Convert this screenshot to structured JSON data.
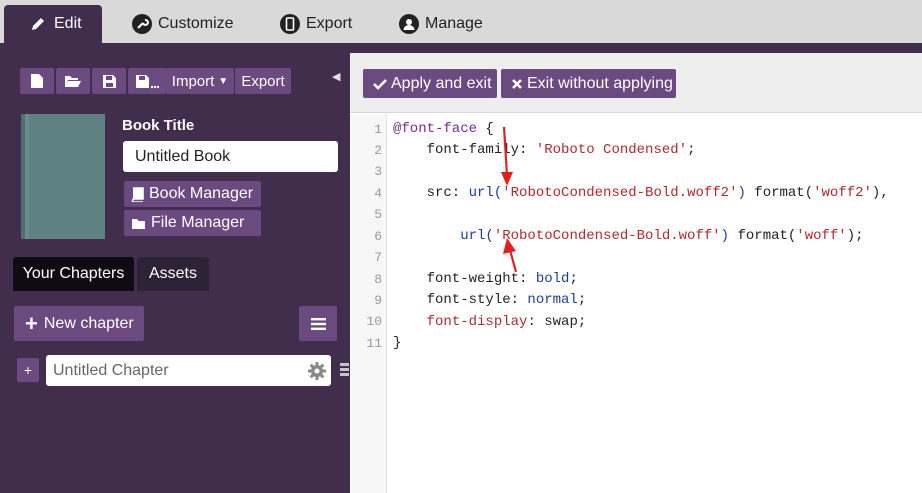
{
  "top_tabs": [
    {
      "label": "Edit",
      "icon": "pencil-icon",
      "active": true
    },
    {
      "label": "Customize",
      "icon": "wrench-icon",
      "active": false
    },
    {
      "label": "Export",
      "icon": "phone-icon",
      "active": false
    },
    {
      "label": "Manage",
      "icon": "user-icon",
      "active": false
    }
  ],
  "toolbar": {
    "import_label": "Import",
    "export_label": "Export"
  },
  "book": {
    "title_label": "Book Title",
    "title_value": "Untitled Book",
    "book_manager_label": "Book Manager",
    "file_manager_label": "File Manager"
  },
  "chapter_tabs": {
    "your_chapters": "Your Chapters",
    "assets": "Assets"
  },
  "new_chapter_label": "New chapter",
  "chapter": {
    "plus_label": "+",
    "title_value": "Untitled Chapter"
  },
  "actions": {
    "apply_label": "Apply and exit",
    "exit_label": "Exit without applying"
  },
  "editor": {
    "line_numbers": [
      "1",
      "2",
      "3",
      "4",
      "5",
      "6",
      "7",
      "8",
      "9",
      "10",
      "11"
    ],
    "lines": {
      "l1_at": "@font-face",
      "l1_brace": " {",
      "l2_prop": "    font-family: ",
      "l2_str": "'Roboto Condensed'",
      "l2_end": ";",
      "l4_prop": "    src: ",
      "l4_fn": "url(",
      "l4_str": "'RobotoCondensed-Bold.woff2'",
      "l4_fn_close": ") ",
      "l4_fmt": "format(",
      "l4_fmt_str": "'woff2'",
      "l4_end": "),",
      "l6_indent": "        ",
      "l6_fn": "url(",
      "l6_str": "'RobotoCondensed-Bold.woff'",
      "l6_fn_close": ") ",
      "l6_fmt": "format(",
      "l6_fmt_str": "'woff'",
      "l6_end": ");",
      "l8_prop": "    font-weight: ",
      "l8_val": "bold",
      "l8_end": ";",
      "l9_prop": "    font-style: ",
      "l9_val": "normal",
      "l9_end": ";",
      "l10_indent": "    ",
      "l10_prop": "font-display",
      "l10_rest": ": swap;",
      "l11_brace": "}"
    }
  },
  "colors": {
    "sidebar_bg": "#402e4c",
    "button_bg": "#6b4a7f",
    "annotation_arrow": "#e02020"
  }
}
